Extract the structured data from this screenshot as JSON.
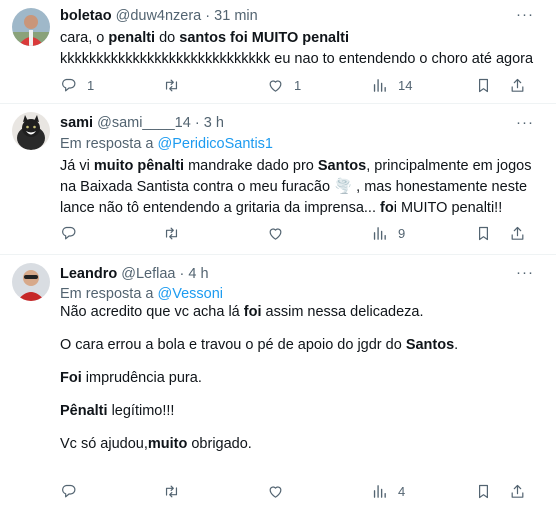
{
  "tweets": [
    {
      "name": "boletao",
      "handle": "@duw4nzera",
      "time": "31 min",
      "text": [
        [
          {
            "t": "cara, o "
          },
          {
            "t": "penalti",
            "b": true
          },
          {
            "t": " do "
          },
          {
            "t": "santos foi MUITO penalti",
            "b": true
          }
        ],
        [
          {
            "t": "kkkkkkkkkkkkkkkkkkkkkkkkkkkkk eu nao to entendendo o choro até agora"
          }
        ]
      ],
      "stats": {
        "replies": "1",
        "retweets": "",
        "likes": "1",
        "views": "14"
      }
    },
    {
      "name": "sami",
      "handle": "@sami____14",
      "time": "3 h",
      "reply_prefix": "Em resposta a ",
      "reply_to": "@PeridicoSantis1",
      "text": [
        [
          {
            "t": "Já vi "
          },
          {
            "t": "muito pênalti",
            "b": true
          },
          {
            "t": " mandrake dado pro "
          },
          {
            "t": "Santos",
            "b": true
          },
          {
            "t": ", principalmente em jogos"
          }
        ],
        [
          {
            "t": "na Baixada Santista contra o meu furacão "
          },
          {
            "t": "🌪️",
            "emoji": true
          },
          {
            "t": " , mas honestamente neste"
          }
        ],
        [
          {
            "t": "lance não tô entendendo a gritaria da imprensa... "
          },
          {
            "t": "fo",
            "b": true
          },
          {
            "t": "i MUITO penalti!!"
          }
        ]
      ],
      "stats": {
        "replies": "",
        "retweets": "",
        "likes": "",
        "views": "9"
      }
    },
    {
      "name": "Leandro",
      "handle": "@Leflaa",
      "time": "4 h",
      "reply_prefix": "Em resposta a ",
      "reply_to": "@Vessoni",
      "text": [
        [
          {
            "t": "Não acredito que vc acha lá "
          },
          {
            "t": "foi",
            "b": true
          },
          {
            "t": " assim nessa delicadeza."
          }
        ],
        [],
        [
          {
            "t": "O cara errou a bola e travou o pé de apoio do jgdr do "
          },
          {
            "t": "Santos",
            "b": true
          },
          {
            "t": "."
          }
        ],
        [],
        [
          {
            "t": "Foi",
            "b": true
          },
          {
            "t": " imprudência pura."
          }
        ],
        [],
        [
          {
            "t": "Pênalti",
            "b": true
          },
          {
            "t": " legítimo!!!"
          }
        ],
        [],
        [
          {
            "t": "Vc só ajudou,"
          },
          {
            "t": "muito",
            "b": true
          },
          {
            "t": " obrigado."
          }
        ]
      ],
      "stats": {
        "replies": "",
        "retweets": "",
        "likes": "",
        "views": "4"
      }
    }
  ],
  "colors": {
    "link": "#1d9bf0",
    "muted": "#536471",
    "text": "#0f1419",
    "separator": "#eff3f4"
  },
  "icons": [
    "more-icon",
    "reply-icon",
    "retweet-icon",
    "like-icon",
    "views-icon",
    "bookmark-icon",
    "share-icon"
  ]
}
